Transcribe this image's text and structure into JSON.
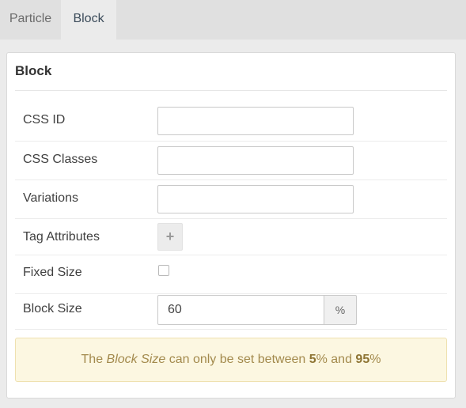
{
  "tabs": [
    {
      "label": "Particle",
      "active": false
    },
    {
      "label": "Block",
      "active": true
    }
  ],
  "panel": {
    "title": "Block",
    "fields": {
      "css_id": {
        "label": "CSS ID",
        "value": ""
      },
      "css_classes": {
        "label": "CSS Classes",
        "value": ""
      },
      "variations": {
        "label": "Variations",
        "value": ""
      },
      "tag_attributes": {
        "label": "Tag Attributes",
        "button": "+"
      },
      "fixed_size": {
        "label": "Fixed Size",
        "checked": false
      },
      "block_size": {
        "label": "Block Size",
        "value": "60",
        "unit": "%"
      }
    },
    "notice": {
      "part1": "The ",
      "em": "Block Size",
      "part2": " can only be set between ",
      "min": "5",
      "part3": "% and ",
      "max": "95",
      "part4": "%"
    }
  },
  "colors": {
    "tab_bar": "#e0e0e0",
    "active_tab_text": "#3b4b5a",
    "notice_bg": "#fcf7e1",
    "notice_text": "#a38a4d"
  }
}
